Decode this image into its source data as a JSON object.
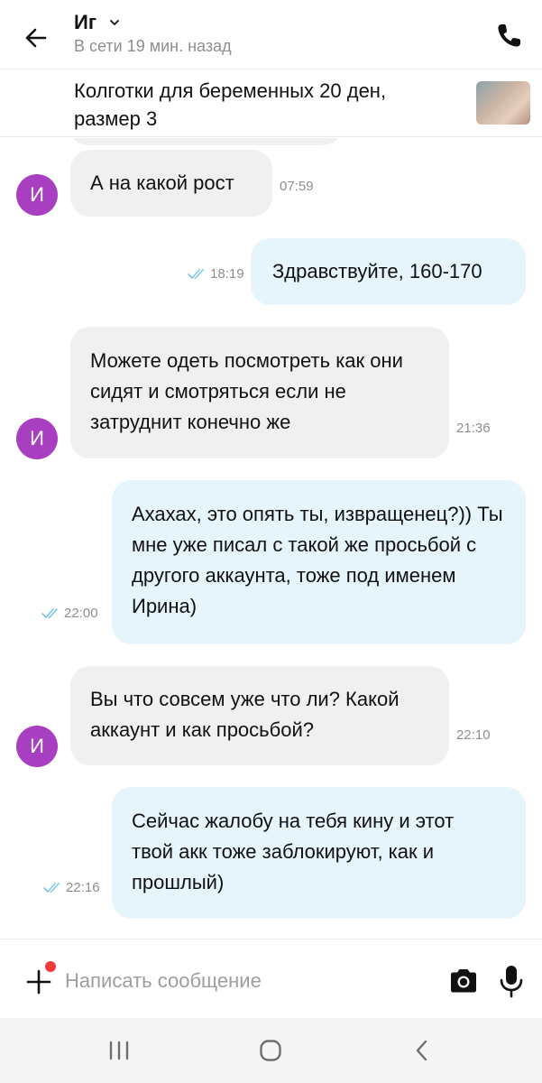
{
  "header": {
    "contact_name": "Иг",
    "status": "В сети 19 мин. назад"
  },
  "product": {
    "title": "Колготки для беременных 20 ден, размер 3"
  },
  "messages": [
    {
      "direction": "in",
      "text": "А на какой рост",
      "time": "07:59",
      "avatar": "И"
    },
    {
      "direction": "out",
      "text": "Здравствуйте, 160-170",
      "time": "18:19"
    },
    {
      "direction": "in",
      "text": "Можете одеть посмотреть как они сидят и смотряться если не затруднит конечно же",
      "time": "21:36",
      "avatar": "И"
    },
    {
      "direction": "out",
      "text": "Ахахах, это опять ты, извращенец?)) Ты мне уже писал с такой же просьбой с другого аккаунта, тоже под именем Ирина)",
      "time": "22:00"
    },
    {
      "direction": "in",
      "text": "Вы что совсем уже что ли? Какой аккаунт и как просьбой?",
      "time": "22:10",
      "avatar": "И"
    },
    {
      "direction": "out",
      "text": "Сейчас жалобу на тебя кину и этот твой акк тоже заблокируют, как и прошлый)",
      "time": "22:16"
    }
  ],
  "input": {
    "placeholder": "Написать сообщение",
    "value": ""
  },
  "icons": {
    "back": "arrow-left-icon",
    "chevron": "chevron-down-icon",
    "call": "phone-icon",
    "plus": "plus-icon",
    "camera": "camera-icon",
    "mic": "microphone-icon",
    "read_receipt": "double-check-icon",
    "nav_recents": "recents-icon",
    "nav_home": "home-icon",
    "nav_back": "back-icon"
  },
  "colors": {
    "incoming_bubble": "#f0f0f0",
    "outgoing_bubble": "#e6f4fc",
    "avatar": "#a83fc0",
    "read_check": "#7dc6ea",
    "notification_dot": "#f03a3a"
  }
}
